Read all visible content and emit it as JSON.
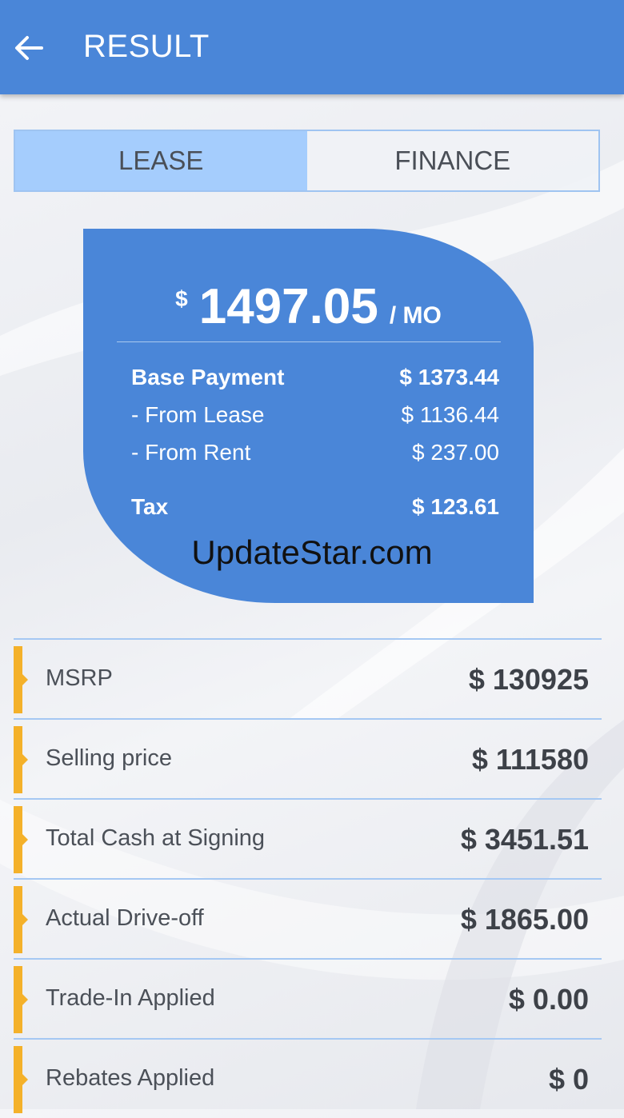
{
  "appbar": {
    "title": "RESULT",
    "back_icon": "arrow-left-icon"
  },
  "tabs": [
    {
      "label": "LEASE",
      "active": true
    },
    {
      "label": "FINANCE",
      "active": false
    }
  ],
  "summary": {
    "currency": "$",
    "monthly_amount": "1497.05",
    "per_label": "/ MO",
    "base_payment": {
      "label": "Base Payment",
      "value": "$ 1373.44"
    },
    "from_lease": {
      "label": "- From Lease",
      "value": "$ 1136.44"
    },
    "from_rent": {
      "label": "- From Rent",
      "value": "$ 237.00"
    },
    "tax": {
      "label": "Tax",
      "value": "$ 123.61"
    }
  },
  "watermark": "UpdateStar.com",
  "details": [
    {
      "label": "MSRP",
      "value": "$ 130925"
    },
    {
      "label": "Selling price",
      "value": "$ 111580"
    },
    {
      "label": "Total Cash at Signing",
      "value": "$ 3451.51"
    },
    {
      "label": "Actual Drive-off",
      "value": "$ 1865.00"
    },
    {
      "label": "Trade-In Applied",
      "value": "$ 0.00"
    },
    {
      "label": "Rebates Applied",
      "value": "$ 0"
    }
  ],
  "colors": {
    "accent": "#4a86d8",
    "tab_active": "#a5cdfd",
    "marker": "#f4b12a"
  }
}
